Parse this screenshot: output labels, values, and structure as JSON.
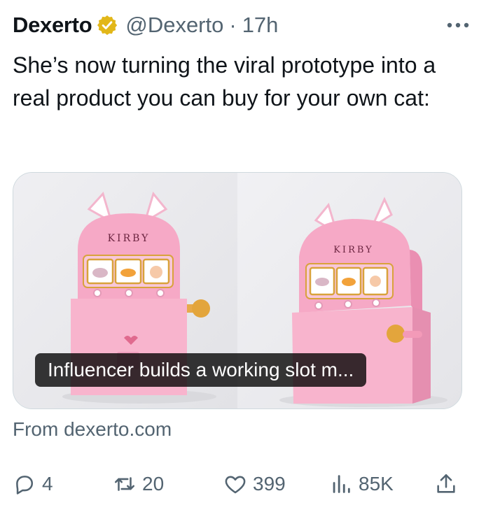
{
  "tweet": {
    "author_name": "Dexerto",
    "handle": "@Dexerto",
    "separator": "·",
    "time": "17h",
    "text": "She’s now turning the viral prototype into a real product you can buy for your own cat:",
    "verified": true
  },
  "card": {
    "caption": "Influencer builds a working slot m...",
    "machine_label": "KIRBY",
    "source": "From dexerto.com"
  },
  "actions": {
    "replies": "4",
    "retweets": "20",
    "likes": "399",
    "views": "85K"
  },
  "icons": [
    "verified-badge-icon",
    "more-icon",
    "reply-icon",
    "retweet-icon",
    "like-icon",
    "views-icon",
    "share-icon"
  ],
  "colors": {
    "text": "#0f1419",
    "muted": "#536471",
    "verified_gold": "#e2b719",
    "machine_pink": "#f6a9c6"
  }
}
